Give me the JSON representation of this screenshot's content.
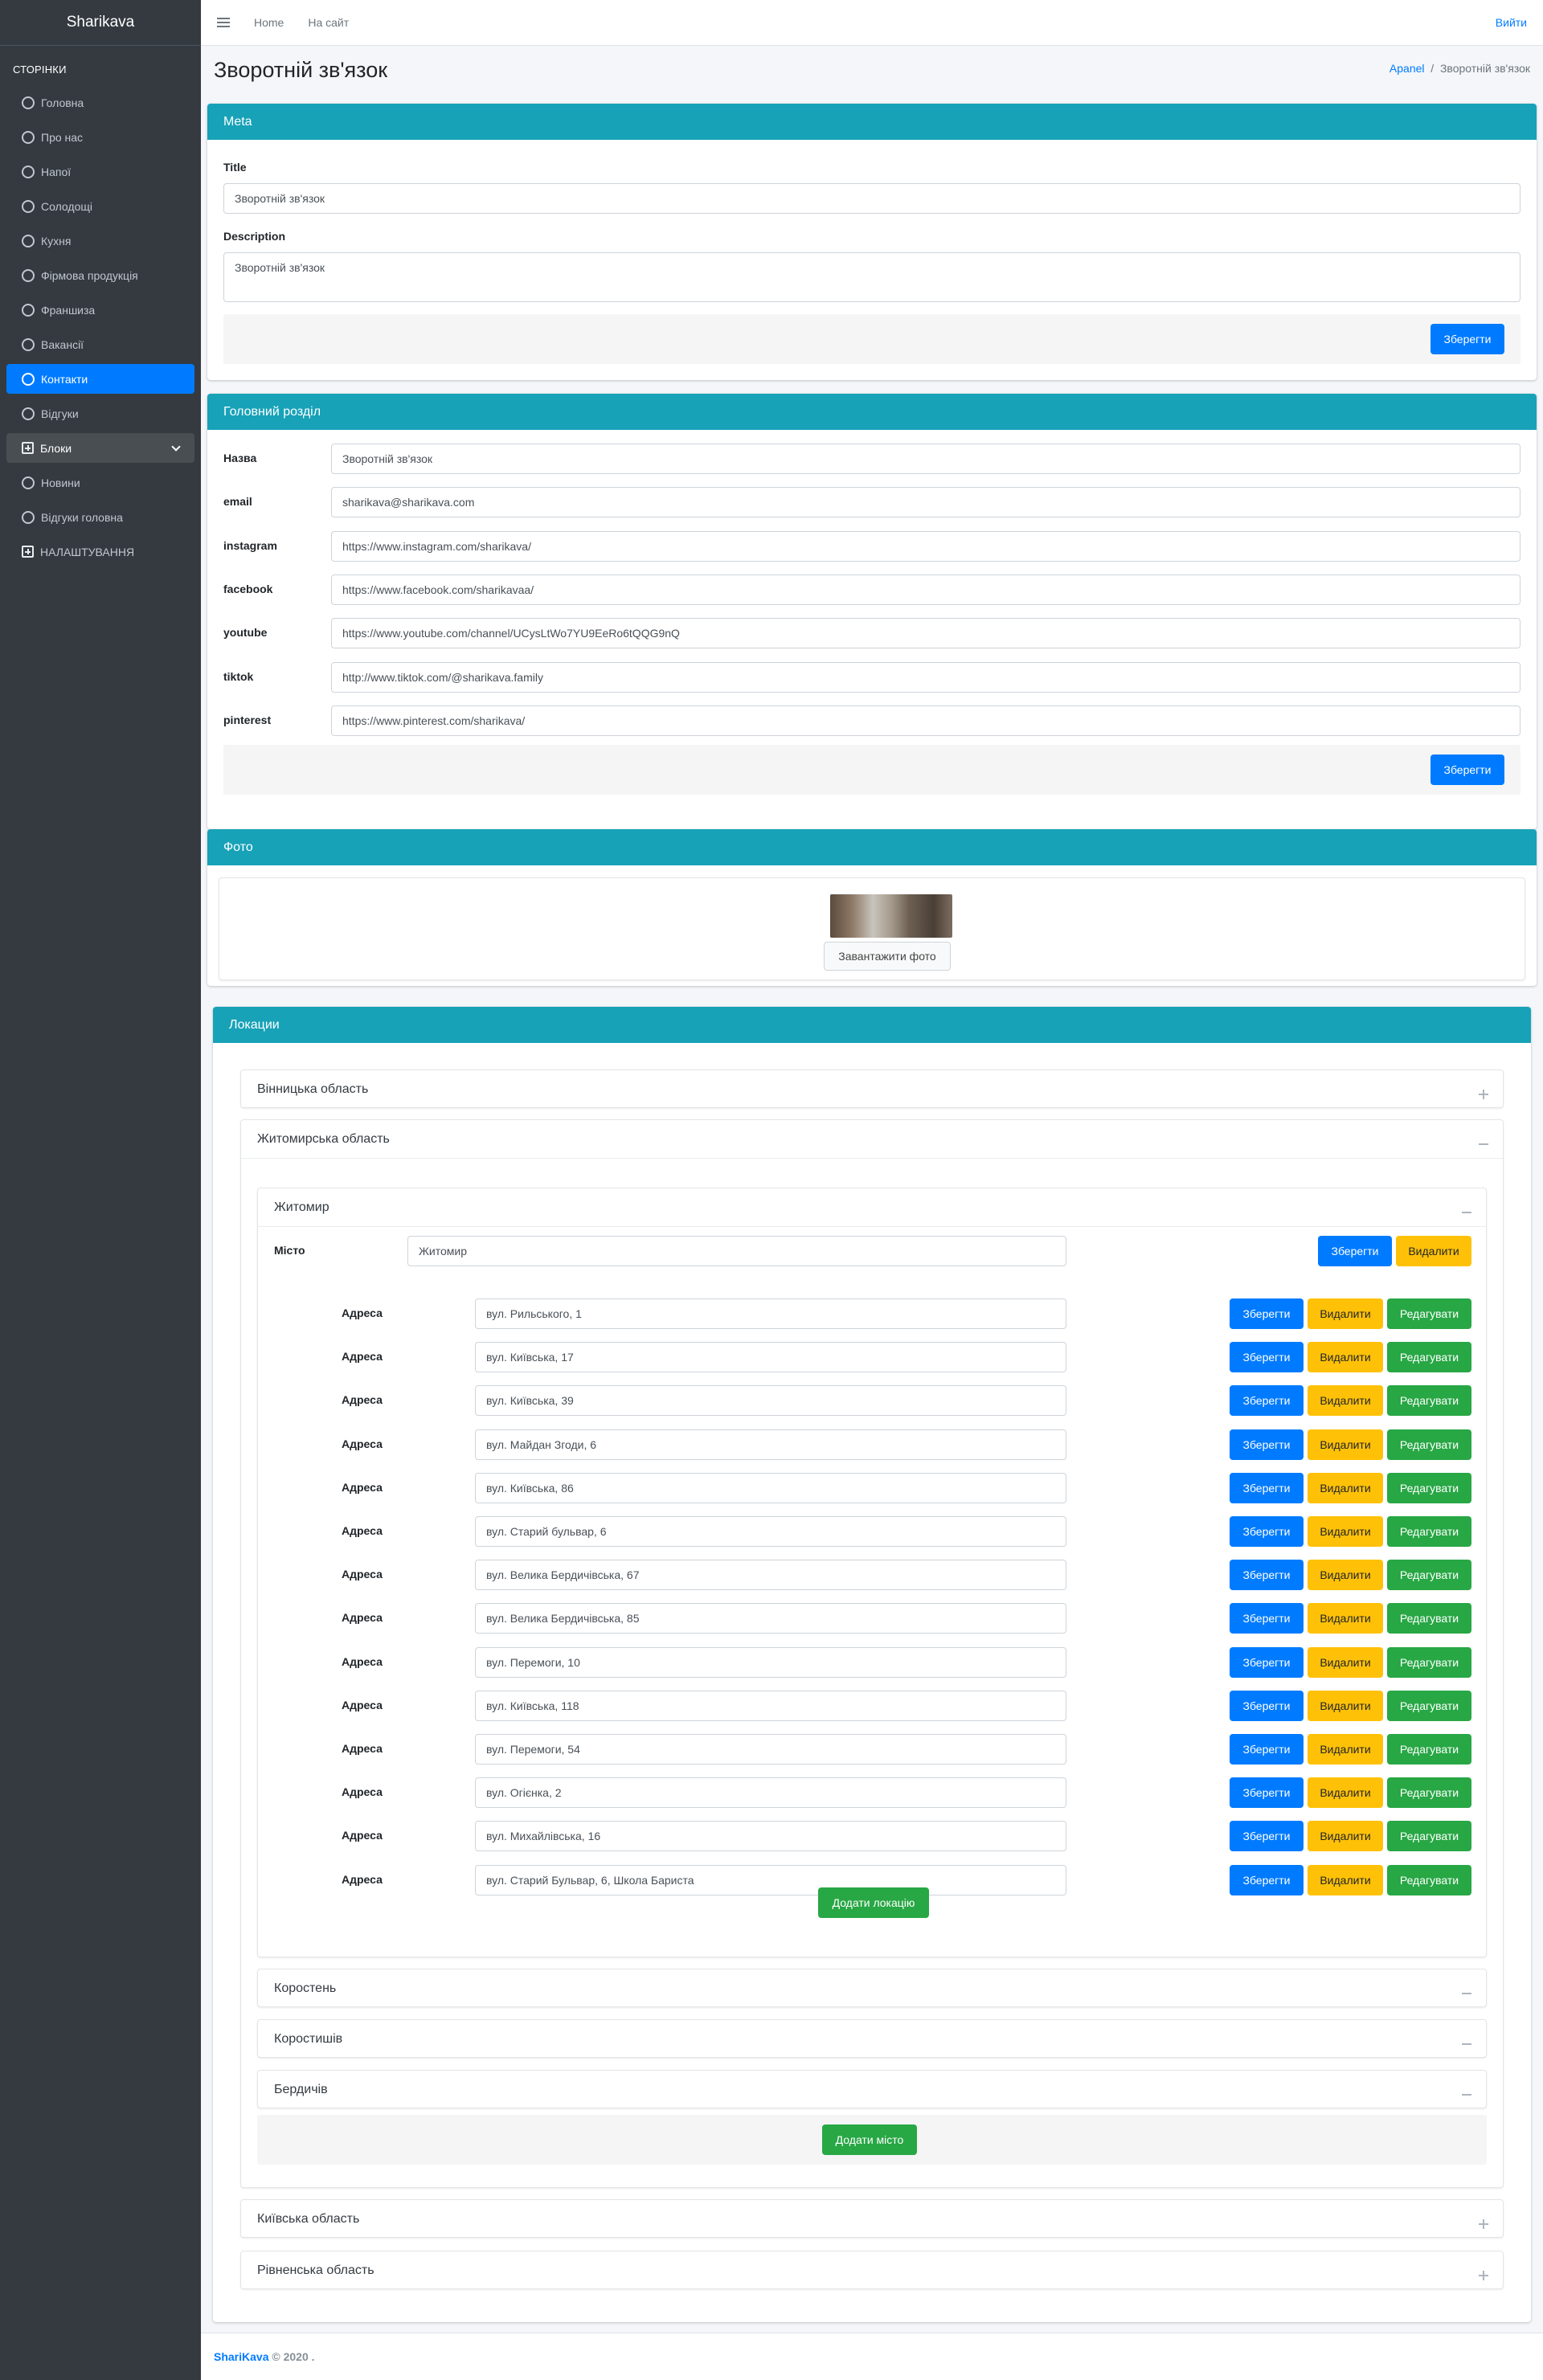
{
  "brand": "Sharikava",
  "sidebar": {
    "header": "СТОРІНКИ",
    "items": [
      {
        "label": "Головна"
      },
      {
        "label": "Про нас"
      },
      {
        "label": "Напої"
      },
      {
        "label": "Солодощі"
      },
      {
        "label": "Кухня"
      },
      {
        "label": "Фірмова продукція"
      },
      {
        "label": "Франшиза"
      },
      {
        "label": "Вакансії"
      },
      {
        "label": "Контакти"
      },
      {
        "label": "Відгуки"
      },
      {
        "label": "Блоки"
      },
      {
        "label": "Новини"
      },
      {
        "label": "Відгуки головна"
      },
      {
        "label": "НАЛАШТУВАННЯ"
      }
    ]
  },
  "topbar": {
    "home": "Home",
    "site": "На сайт",
    "logout": "Вийти"
  },
  "page": {
    "title": "Зворотній зв'язок",
    "breadcrumb_root": "Apanel",
    "breadcrumb_sep": "/",
    "breadcrumb_current": "Зворотній зв'язок"
  },
  "meta": {
    "header": "Meta",
    "title_label": "Title",
    "title_value": "Зворотній зв'язок",
    "desc_label": "Description",
    "desc_value": "Зворотній зв'язок",
    "save": "Зберегти"
  },
  "main": {
    "header": "Головний розділ",
    "fields": [
      {
        "label": "Назва",
        "value": "Зворотній зв'язок"
      },
      {
        "label": "email",
        "value": "sharikava@sharikava.com"
      },
      {
        "label": "instagram",
        "value": "https://www.instagram.com/sharikava/"
      },
      {
        "label": "facebook",
        "value": "https://www.facebook.com/sharikavaa/"
      },
      {
        "label": "youtube",
        "value": "https://www.youtube.com/channel/UCysLtWo7YU9EeRo6tQQG9nQ"
      },
      {
        "label": "tiktok",
        "value": "http://www.tiktok.com/@sharikava.family"
      },
      {
        "label": "pinterest",
        "value": "https://www.pinterest.com/sharikava/"
      }
    ],
    "save": "Зберегти"
  },
  "photo": {
    "header": "Фото",
    "upload": "Завантажити фото"
  },
  "locations": {
    "header": "Локации",
    "regions": [
      "Вінницька область",
      "Житомирська область",
      "Київська область",
      "Рівненська область"
    ],
    "city": {
      "name": "Житомир",
      "label": "Місто",
      "value": "Житомир",
      "save": "Зберегти",
      "delete": "Видалити"
    },
    "address_label": "Адреса",
    "addresses": [
      "вул. Рильського, 1",
      "вул. Київська, 17",
      "вул. Київська, 39",
      "вул. Майдан Згоди, 6",
      "вул. Київська, 86",
      "вул. Старий бульвар, 6",
      "вул. Велика Бердичівська, 67",
      "вул. Велика Бердичівська, 85",
      "вул. Перемоги, 10",
      "вул. Київська, 118",
      "вул. Перемоги, 54",
      "вул. Огієнка, 2",
      "вул. Михайлівська, 16",
      "вул. Старий Бульвар, 6, Школа Бариста"
    ],
    "btn_save": "Зберегти",
    "btn_delete": "Видалити",
    "btn_edit": "Редагувати",
    "add_location": "Додати локацію",
    "other_cities": [
      "Коростень",
      "Коростишів",
      "Бердичів"
    ],
    "add_city": "Додати місто"
  },
  "footer": {
    "brand": "ShariKava",
    "copy": "© 2020 ."
  }
}
